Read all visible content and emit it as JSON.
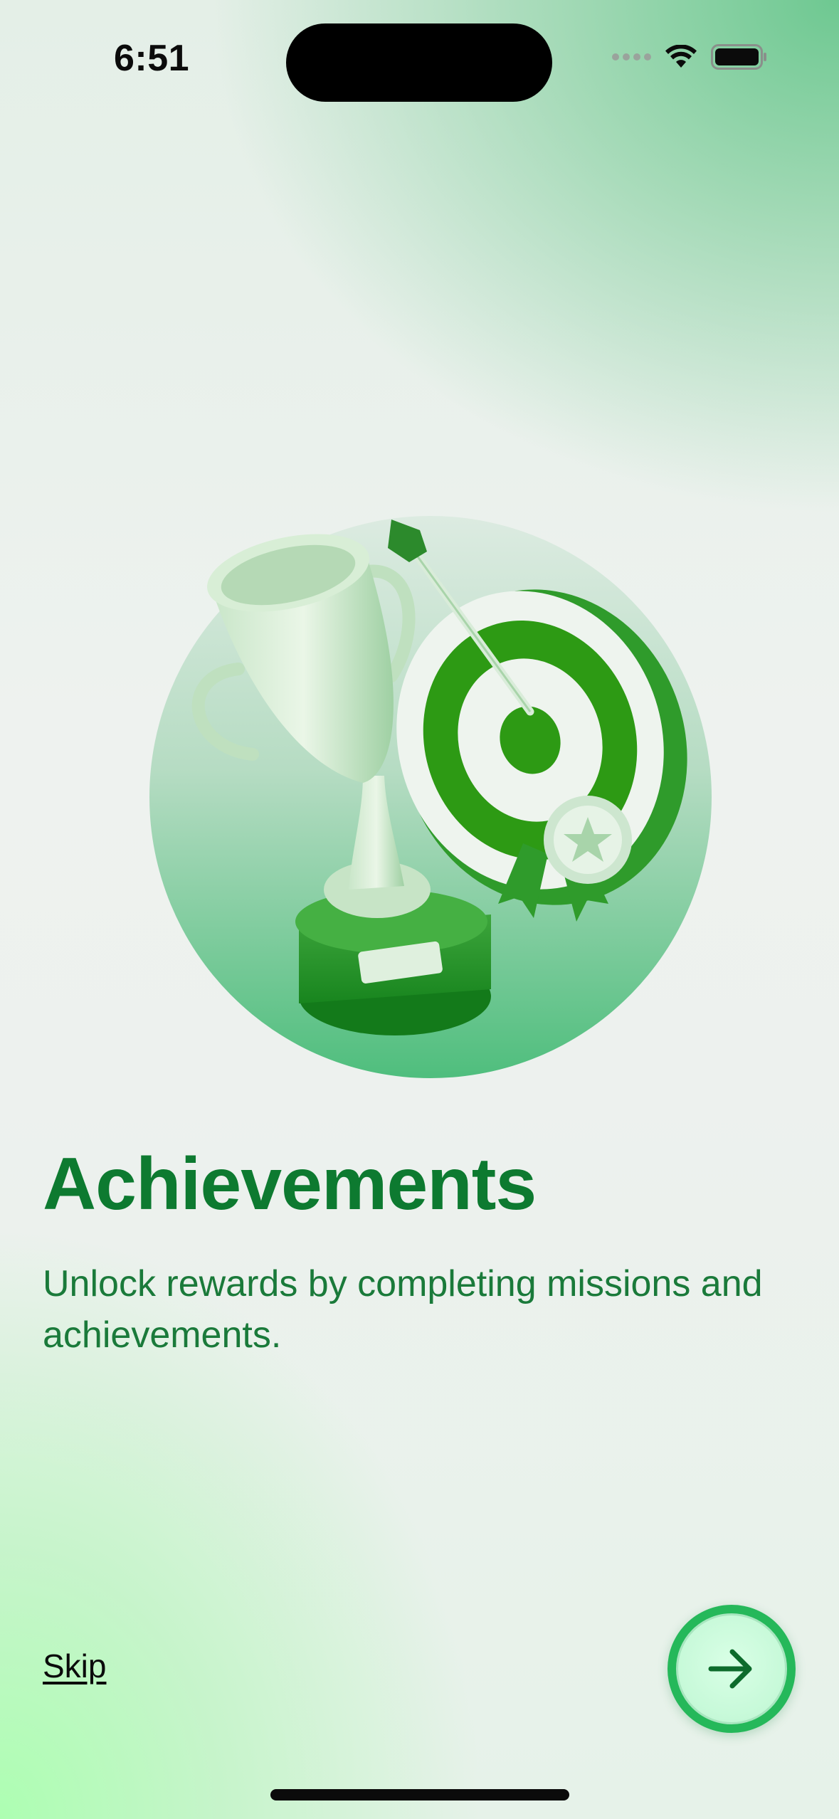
{
  "status_bar": {
    "time": "6:51"
  },
  "onboarding": {
    "title": "Achievements",
    "subtitle": "Unlock rewards by completing missions and achievements."
  },
  "controls": {
    "skip_label": "Skip"
  },
  "icons": {
    "hero": "trophy-and-target-illustration",
    "next": "arrow-right-icon",
    "wifi": "wifi-icon",
    "battery": "battery-icon"
  },
  "colors": {
    "accent": "#0d7a30",
    "button": "#25b85a",
    "button_inner": "#c6f9d8"
  }
}
